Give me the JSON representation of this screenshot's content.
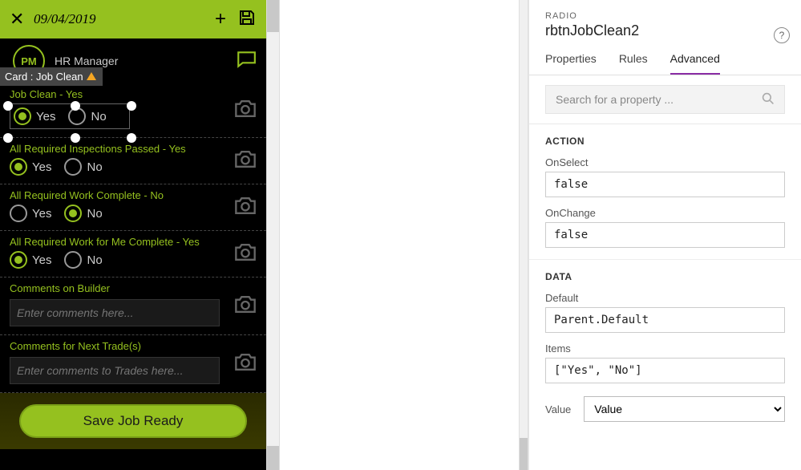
{
  "app": {
    "date": "09/04/2019",
    "avatar_initials": "PM",
    "user_role": "HR Manager",
    "selection_badge": "Card : Job Clean",
    "fields": {
      "job_clean": {
        "label": "Job Clean - Yes",
        "yes": "Yes",
        "no": "No"
      },
      "inspections": {
        "label": "All Required Inspections Passed - Yes",
        "yes": "Yes",
        "no": "No"
      },
      "work_complete": {
        "label": "All Required Work Complete - No",
        "yes": "Yes",
        "no": "No"
      },
      "work_for_me": {
        "label": "All Required Work for Me Complete - Yes",
        "yes": "Yes",
        "no": "No"
      },
      "comments_builder": {
        "label": "Comments on Builder",
        "placeholder": "Enter comments here..."
      },
      "comments_trades": {
        "label": "Comments for Next Trade(s)",
        "placeholder": "Enter comments to Trades here..."
      }
    },
    "save_button": "Save Job Ready"
  },
  "panel": {
    "type_label": "RADIO",
    "control_name": "rbtnJobClean2",
    "tabs": {
      "properties": "Properties",
      "rules": "Rules",
      "advanced": "Advanced"
    },
    "search_placeholder": "Search for a property ...",
    "sections": {
      "action": "ACTION",
      "data": "DATA"
    },
    "props": {
      "onselect_label": "OnSelect",
      "onselect_value": "false",
      "onchange_label": "OnChange",
      "onchange_value": "false",
      "default_label": "Default",
      "default_value": "Parent.Default",
      "items_label": "Items",
      "items_value": "[\"Yes\", \"No\"]",
      "value_label": "Value",
      "value_option": "Value"
    }
  }
}
